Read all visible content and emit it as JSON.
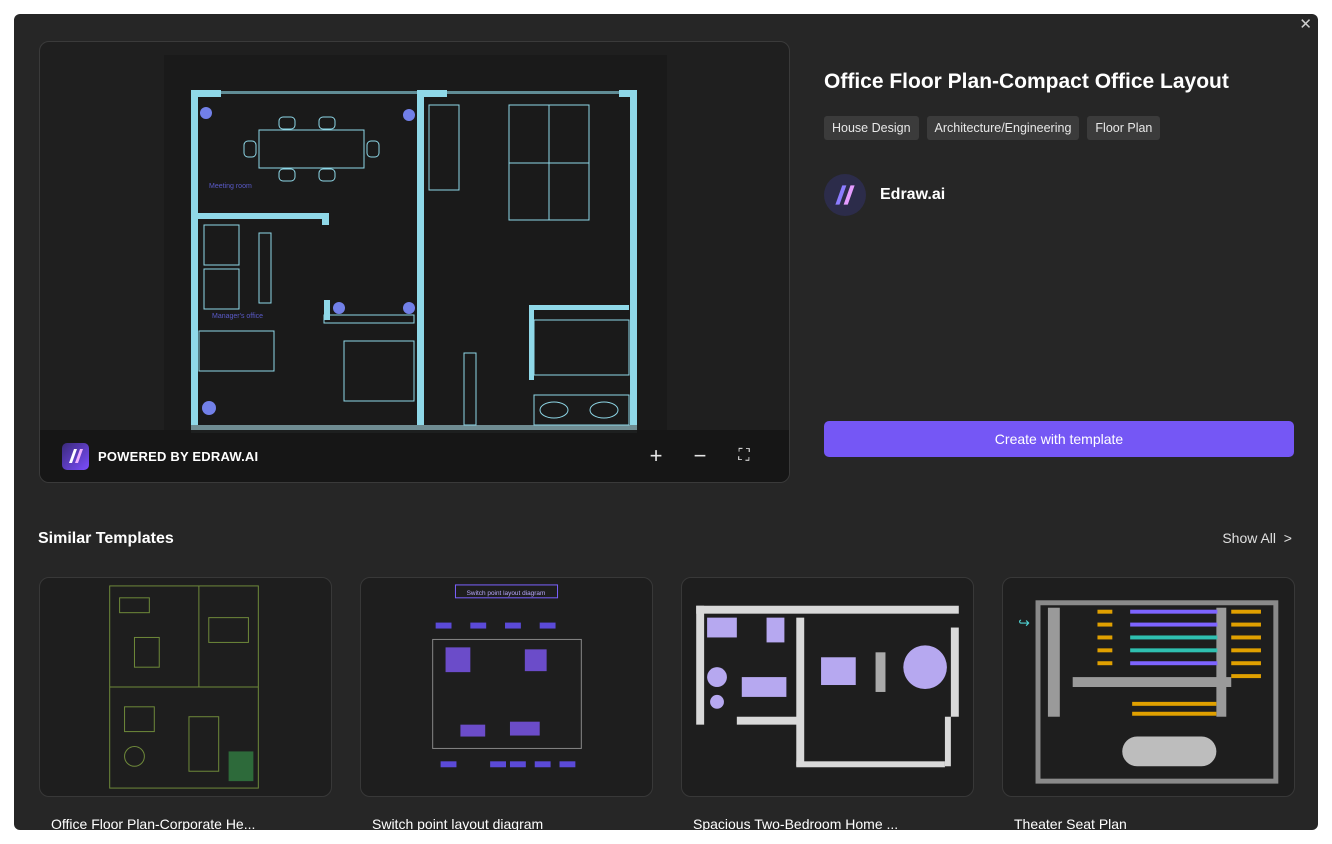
{
  "template": {
    "title": "Office Floor Plan-Compact Office Layout",
    "tags": [
      "House Design",
      "Architecture/Engineering",
      "Floor Plan"
    ],
    "author": "Edraw.ai",
    "create_label": "Create with template"
  },
  "preview": {
    "powered_label": "POWERED BY EDRAW.AI",
    "room_labels": [
      "Meeting room",
      "Manager's office"
    ],
    "icons": [
      "plus-icon",
      "minus-icon",
      "fullscreen-icon"
    ]
  },
  "similar": {
    "heading": "Similar Templates",
    "show_all": "Show All",
    "cards": [
      {
        "title": "Office Floor Plan-Corporate He..."
      },
      {
        "title": "Switch point layout diagram",
        "thumb_heading": "Switch point layout diagram"
      },
      {
        "title": "Spacious Two-Bedroom Home ..."
      },
      {
        "title": "Theater Seat Plan"
      }
    ]
  },
  "colors": {
    "accent": "#7557f5",
    "wall": "#8fd8e8",
    "purple": "#7b61ff"
  }
}
